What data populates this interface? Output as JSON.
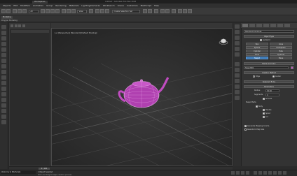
{
  "titlebar": {
    "file_tab": "Workspaces",
    "app_title": "Untitled - Autodesk 3ds Max 2018"
  },
  "menu": {
    "items": [
      "Objects",
      "Edit",
      "Modifiers",
      "Animation",
      "Group",
      "Rendering",
      "Materials",
      "Lighting/Cameras",
      "Workbench",
      "Scene",
      "Customize",
      "MAXScript",
      "Help"
    ]
  },
  "toolbar": {
    "selection_filter": "All",
    "ref_coord": "View",
    "named_selection": "Create Selection Set"
  },
  "ribbon": {
    "tab_label": "Modeling",
    "sub_label": "Polygon Modeling"
  },
  "viewport": {
    "label": "[+] [Perspective] [Standard] [Default Shading]"
  },
  "command_panel": {
    "category_dropdown": "Standard Primitives",
    "object_type_rollout": "Object Type",
    "autogrid_label": "AutoGrid",
    "object_buttons": [
      "Box",
      "Cone",
      "Sphere",
      "GeoSphere",
      "Cylinder",
      "Tube",
      "Torus",
      "Pyramid",
      "Teapot",
      "Plane"
    ],
    "name_color_rollout": "Name and Color",
    "object_name": "Teapot001",
    "object_color": "#c04cc0",
    "creation_method_rollout": "Creation Method",
    "creation_methods": [
      "Edge",
      "Center"
    ],
    "keyboard_entry_rollout": "Keyboard Entry",
    "parameters_rollout": "Parameters",
    "radius_label": "Radius:",
    "radius_value": "32.66",
    "segments_label": "Segments:",
    "segments_value": "4",
    "smooth_label": "Smooth",
    "teapot_parts_label": "Teapot Parts",
    "parts": [
      "Body",
      "Handle",
      "Spout",
      "Lid"
    ],
    "gen_mapping_label": "Generate Mapping Coords.",
    "real_world_label": "Real-World Map Size"
  },
  "timebar": {
    "slider_label": "0 / 100"
  },
  "status": {
    "maxscript_text": "Welcome to MAXScript.",
    "line1": "1 Object Selected",
    "line2": "Click and drag to begin creation process"
  }
}
